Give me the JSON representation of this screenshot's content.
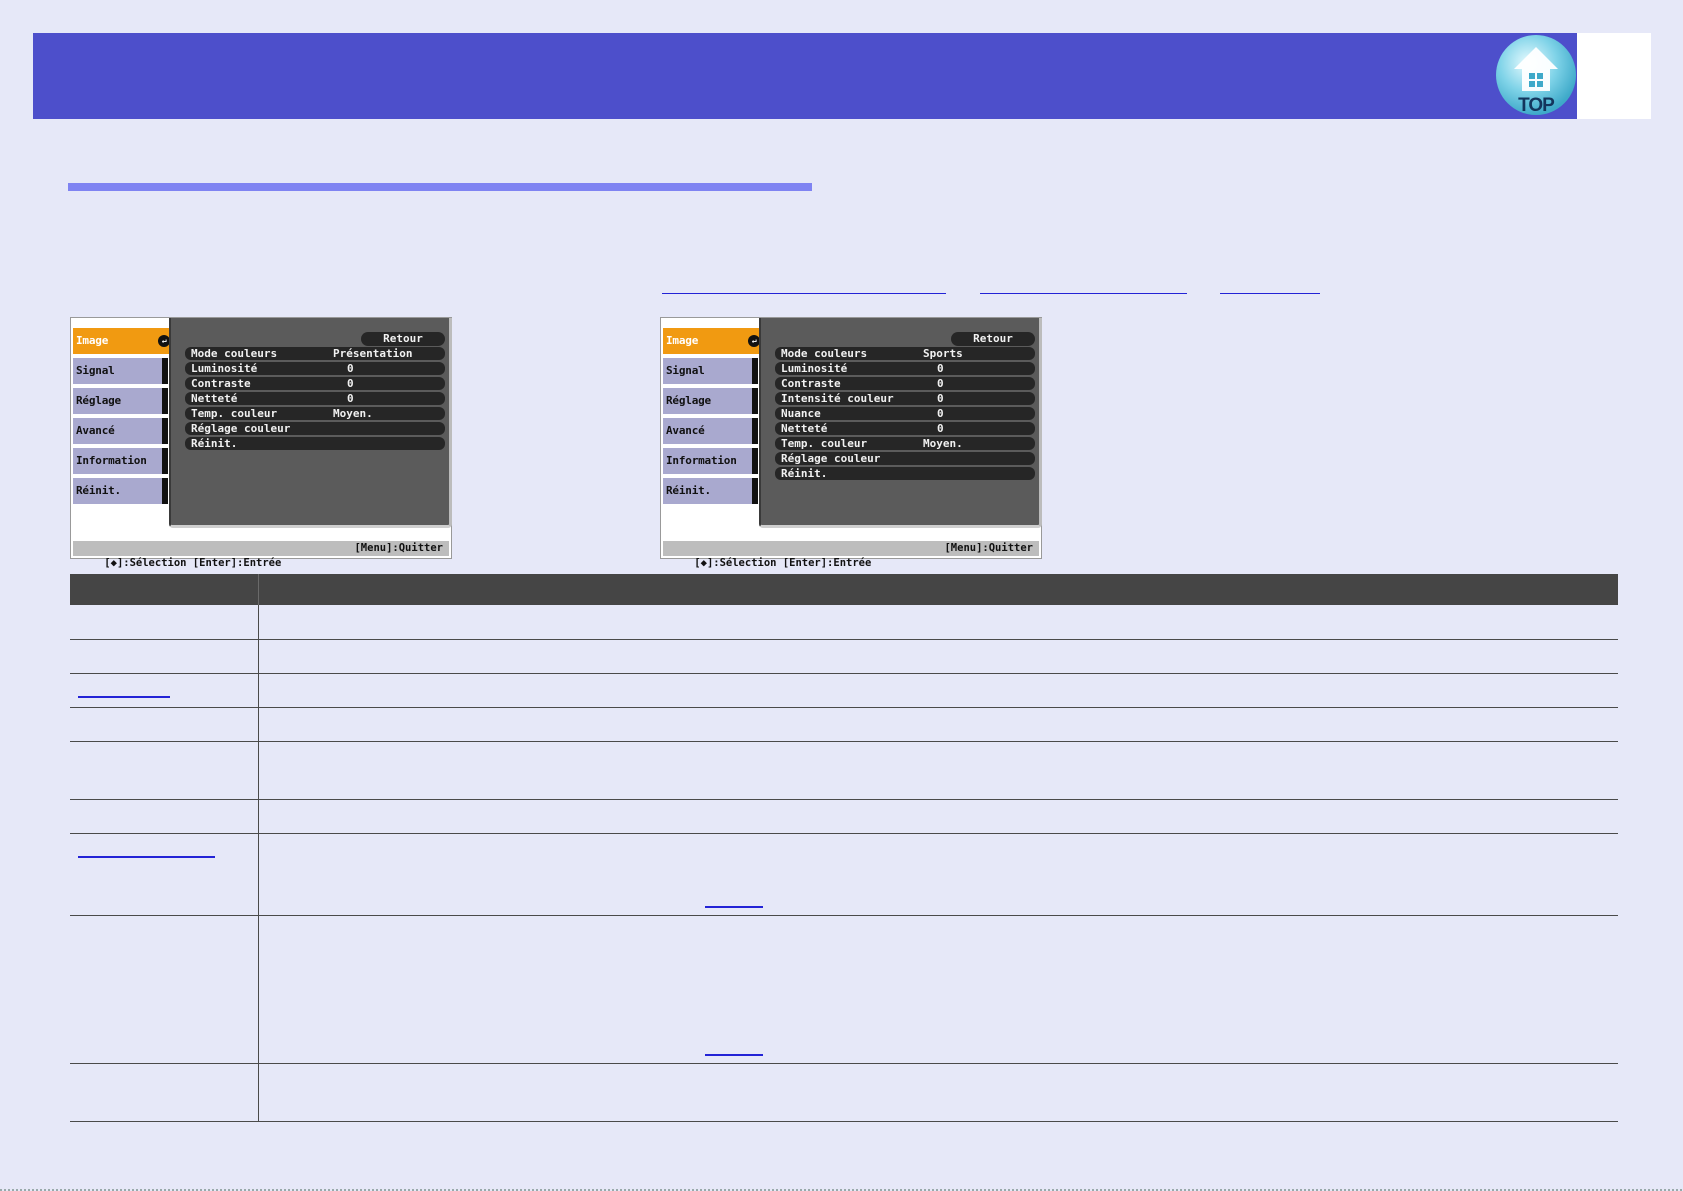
{
  "header": {
    "top_button_label": "TOP"
  },
  "osd_menus": [
    {
      "tabs": [
        "Image",
        "Signal",
        "Réglage",
        "Avancé",
        "Information",
        "Réinit."
      ],
      "active_tab": "Image",
      "retour": "Retour",
      "rows": [
        {
          "label": "Mode couleurs",
          "value": "Présentation"
        },
        {
          "label": "Luminosité",
          "value": "0"
        },
        {
          "label": "Contraste",
          "value": "0"
        },
        {
          "label": "Netteté",
          "value": "0"
        },
        {
          "label": "Temp. couleur",
          "value": "Moyen."
        },
        {
          "label": "Réglage couleur",
          "value": ""
        },
        {
          "label": "Réinit.",
          "value": ""
        }
      ],
      "footer_left": "[◆]:Sélection [Enter]:Entrée",
      "footer_right": "[Menu]:Quitter"
    },
    {
      "tabs": [
        "Image",
        "Signal",
        "Réglage",
        "Avancé",
        "Information",
        "Réinit."
      ],
      "active_tab": "Image",
      "retour": "Retour",
      "rows": [
        {
          "label": "Mode couleurs",
          "value": "Sports"
        },
        {
          "label": "Luminosité",
          "value": "0"
        },
        {
          "label": "Contraste",
          "value": "0"
        },
        {
          "label": "Intensité couleur",
          "value": "0"
        },
        {
          "label": "Nuance",
          "value": "0"
        },
        {
          "label": "Netteté",
          "value": "0"
        },
        {
          "label": "Temp. couleur",
          "value": "Moyen."
        },
        {
          "label": "Réglage couleur",
          "value": ""
        },
        {
          "label": "Réinit.",
          "value": ""
        }
      ],
      "footer_left": "[◆]:Sélection [Enter]:Entrée",
      "footer_right": "[Menu]:Quitter"
    }
  ],
  "colors": {
    "banner": "#4d4fcb",
    "title_rule": "#7f83f2",
    "link": "#2323d6",
    "active_tab": "#f19a11",
    "background": "#e6e8f8"
  }
}
